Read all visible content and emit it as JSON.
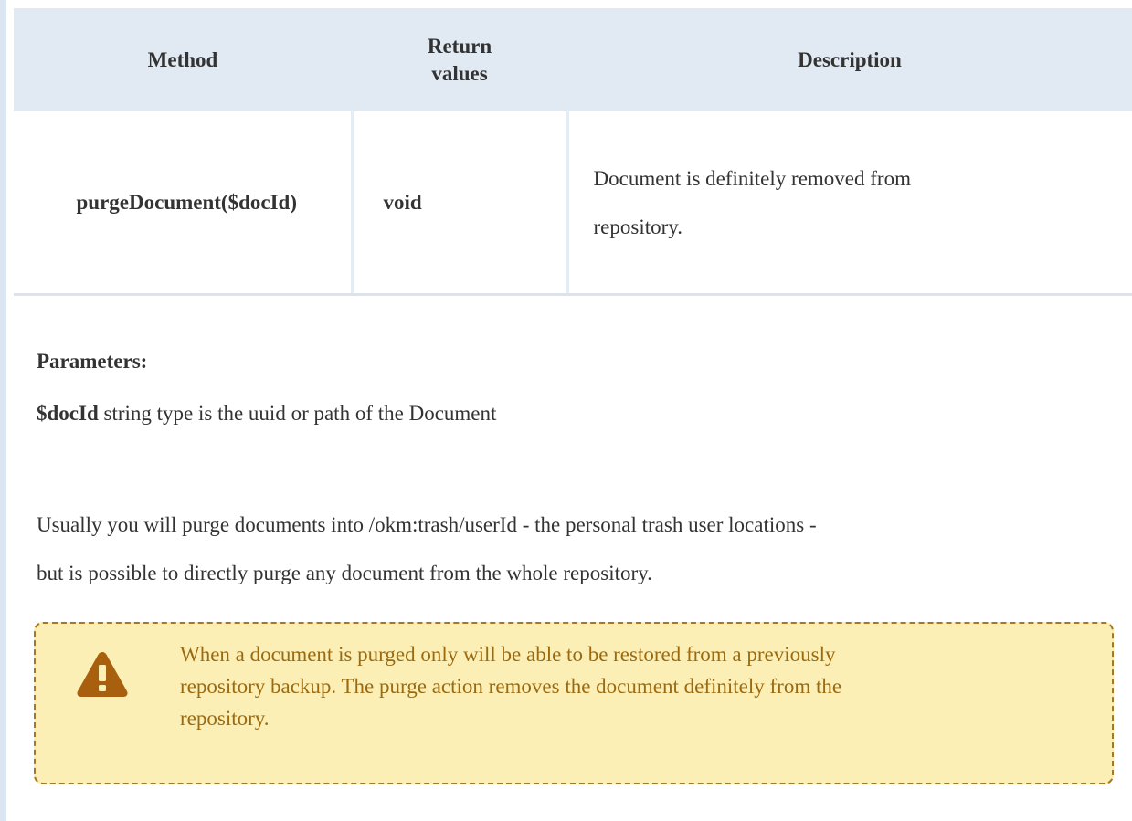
{
  "table": {
    "headers": {
      "method": "Method",
      "return_line1": "Return",
      "return_line2": "values",
      "description": "Description"
    },
    "rows": [
      {
        "method": "purgeDocument($docId)",
        "return_value": "void",
        "description_line1": "Document is definitely removed from",
        "description_line2": "repository."
      }
    ]
  },
  "parameters": {
    "heading": "Parameters:",
    "param_name": "$docId",
    "param_desc": " string type is the uuid or path of the Document"
  },
  "usage": {
    "line1": "Usually you will purge documents into /okm:trash/userId - the personal trash user locations -",
    "line2": "but is possible to directly purge any document from the whole repository."
  },
  "warning": {
    "icon": "warning-triangle-icon",
    "color": "#a8781d",
    "background": "#fcefb6",
    "line1": "When a document is purged only will be able to be restored from a previously",
    "line2": "repository backup. The purge action removes the document definitely from the",
    "line3": "repository."
  }
}
